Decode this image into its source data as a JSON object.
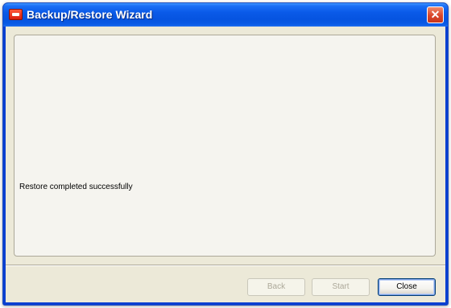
{
  "window": {
    "title": "Backup/Restore Wizard",
    "close_glyph": "✕"
  },
  "content": {
    "status": "Restore completed successfully"
  },
  "buttons": {
    "back": "Back",
    "start": "Start",
    "close": "Close"
  },
  "colors": {
    "titlebar": "#0a5ae8",
    "client": "#ece9d8",
    "panel": "#f5f4ef",
    "close_button": "#d9452a"
  },
  "icons": {
    "app": "app-icon",
    "close": "close-icon"
  }
}
